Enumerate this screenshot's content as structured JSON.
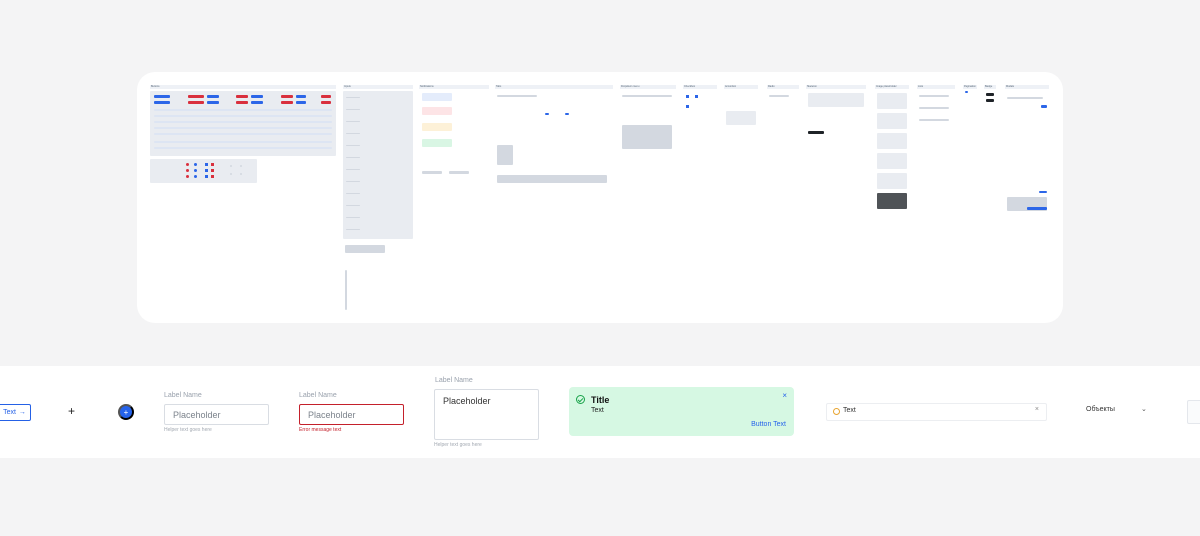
{
  "overview": {
    "section_titles": [
      "Buttons",
      "Inputs",
      "Notifications",
      "Tabs",
      "Dropdown menu",
      "Checkbox",
      "Accordion",
      "Radio",
      "Skeleton",
      "Image placeholder",
      "Lists",
      "Pagination",
      "Badge",
      "Modals"
    ]
  },
  "components": {
    "outline_button": {
      "label": "Text",
      "icon": "arrow-right-icon"
    },
    "icon_button": {
      "icon": "plus-icon"
    },
    "fab_button": {
      "icon": "plus-icon"
    },
    "text_input": {
      "label": "Label Name",
      "placeholder": "Placeholder",
      "helper": "Helper text goes here"
    },
    "error_input": {
      "label": "Label Name",
      "placeholder": "Placeholder",
      "error": "Error message text"
    },
    "textarea": {
      "label": "Label Name",
      "placeholder": "Placeholder",
      "helper": "Helper text goes here"
    },
    "toast": {
      "title": "Title",
      "text": "Text",
      "action": "Button Text",
      "close": "×",
      "icon": "check-circle-icon",
      "color": "#d6f8e3"
    },
    "chip_input": {
      "value": "Text",
      "close": "×",
      "icon": "warning-circle-icon"
    },
    "select": {
      "value": "Объекты",
      "icon": "chevron-down-icon"
    }
  },
  "colors": {
    "primary": "#2563eb",
    "danger": "#c4202b",
    "success_bg": "#d6f8e3",
    "page_bg": "#f4f4f5"
  }
}
